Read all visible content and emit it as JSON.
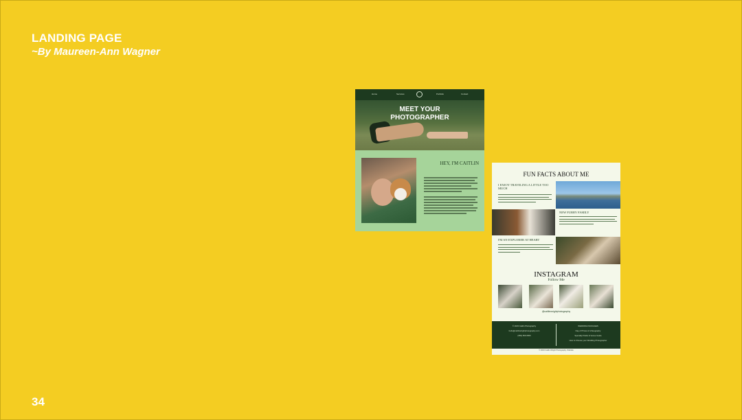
{
  "slide": {
    "title": "LANDING PAGE",
    "subtitle": "~By Maureen-Ann Wagner",
    "page_number": "34"
  },
  "mockup1": {
    "nav": [
      "Home",
      "Services",
      "Portfolio",
      "Contact"
    ],
    "headline_line1": "MEET YOUR",
    "headline_line2": "PHOTOGRAPHER",
    "greeting": "HEY, I'M CAITLIN"
  },
  "mockup2": {
    "title": "FUN FACTS ABOUT ME",
    "fact1": "I ENJOY TRAVELING A LITTLE TOO MUCH",
    "fact2": "NEW FURRY FAMILY",
    "fact3": "I'M AN EXPLORER AT HEART",
    "instagram": "INSTAGRAM",
    "follow": "Follow Me",
    "handle": "@caitlinwrightphotography",
    "footer_left": [
      "© 2023 Caitlin Photography",
      "hello@caitlinwrightphotography.com",
      "(555) 555-5555"
    ],
    "footer_right": [
      "WEDDING PACKAGES",
      "Day of Photos & Videography",
      "Specialty Packs & Venue Guide",
      "How to Choose your Wedding Photographer"
    ],
    "copyright": "© 2023 Caitlin Wright Photography. Website"
  },
  "colors": {
    "background": "#f4cd22",
    "dark_green": "#1d3a1f",
    "light_green": "#a6d49a",
    "cream": "#f4f8ea"
  }
}
